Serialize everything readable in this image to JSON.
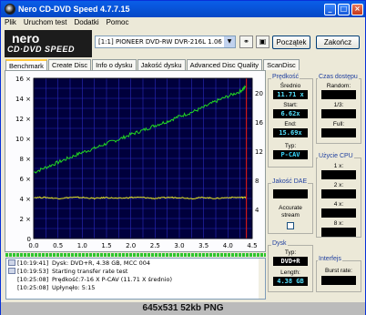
{
  "window": {
    "title": "Nero CD-DVD Speed 4.7.7.15"
  },
  "menu": [
    "Plik",
    "Uruchom test",
    "Dodatki",
    "Pomoc"
  ],
  "logo": {
    "line1": "nero",
    "line2": "CD·DVD SPEED"
  },
  "drive": {
    "value": "[1:1]  PIONEER DVD-RW  DVR-216L 1.06"
  },
  "buttons": {
    "start": "Początek",
    "stop": "Zakończ"
  },
  "tabs": [
    "Benchmark",
    "Create Disc",
    "Info o dysku",
    "Jakość dysku",
    "Advanced Disc Quality",
    "ScanDisc"
  ],
  "chart_data": {
    "type": "line",
    "x": [
      0.0,
      0.25,
      0.5,
      0.75,
      1.0,
      1.25,
      1.5,
      1.75,
      2.0,
      2.25,
      2.5,
      2.75,
      3.0,
      3.25,
      3.5,
      3.75,
      4.0,
      4.25,
      4.38
    ],
    "series": [
      {
        "values": [
          6.6,
          7.1,
          7.6,
          8.1,
          8.6,
          9.0,
          9.5,
          9.9,
          10.4,
          10.8,
          11.3,
          11.7,
          12.2,
          12.6,
          13.1,
          13.7,
          14.2,
          14.7,
          15.2
        ],
        "color": "#22d722"
      },
      {
        "values": [
          4.1,
          4.1,
          4.0,
          4.1,
          4.1,
          4.0,
          4.1,
          4.0,
          4.1,
          4.1,
          4.0,
          4.1,
          4.1,
          4.0,
          4.1,
          4.0,
          4.1,
          4.1,
          4.1
        ],
        "color": "#e6e61e"
      }
    ],
    "left_ticks": [
      "0",
      "2 ×",
      "4 ×",
      "6 ×",
      "8 ×",
      "10 ×",
      "12 ×",
      "14 ×",
      "16 ×"
    ],
    "right_ticks": [
      "4",
      "8",
      "12",
      "16",
      "20"
    ],
    "x_ticks": [
      "0.0",
      "0.5",
      "1.0",
      "1.5",
      "2.0",
      "2.5",
      "3.0",
      "3.5",
      "4.0",
      "4.5"
    ],
    "xlim": [
      0,
      4.5
    ],
    "ylim": [
      0,
      16
    ],
    "grid": true,
    "background": "#00003c",
    "grid_color": "#2a2abf",
    "marker_color": "#d01818"
  },
  "speed_panel": {
    "title": "Prędkość",
    "avg_label": "Średnio",
    "avg_value": "11.71 x",
    "start_label": "Start:",
    "start_value": "6.62x",
    "end_label": "End:",
    "end_value": "15.69x",
    "type_label": "Typ:",
    "type_value": "P-CAV"
  },
  "access_panel": {
    "title": "Czas dostępu",
    "random_label": "Random:",
    "third_label": "1/3:",
    "full_label": "Full:"
  },
  "cpu_panel": {
    "title": "Użycie CPU",
    "labels": [
      "1 x:",
      "2 x:",
      "4 x:",
      "8 x:"
    ]
  },
  "dae_panel": {
    "title": "Jakość DAE",
    "stream_label": "Accurate stream"
  },
  "disc_panel": {
    "title": "Dysk",
    "type_label": "Typ:",
    "type_value": "DVD+R",
    "length_label": "Length:",
    "length_value": "4.38 GB"
  },
  "interface_panel": {
    "title": "Interfejs",
    "burst_label": "Burst rate:"
  },
  "log": [
    {
      "time": "[10:19:41]",
      "text": "Dysk: DVD+R, 4.38 GB, MCC 004"
    },
    {
      "time": "[10:19:53]",
      "text": "Starting transfer rate test"
    },
    {
      "time": "[10:25:08]",
      "text": "Prędkość:7-16 X P-CAV (11.71 X średnio)"
    },
    {
      "time": "[10:25:08]",
      "text": "Upłynęło: 5:15"
    }
  ],
  "status_caption": "645x531 52kb PNG"
}
